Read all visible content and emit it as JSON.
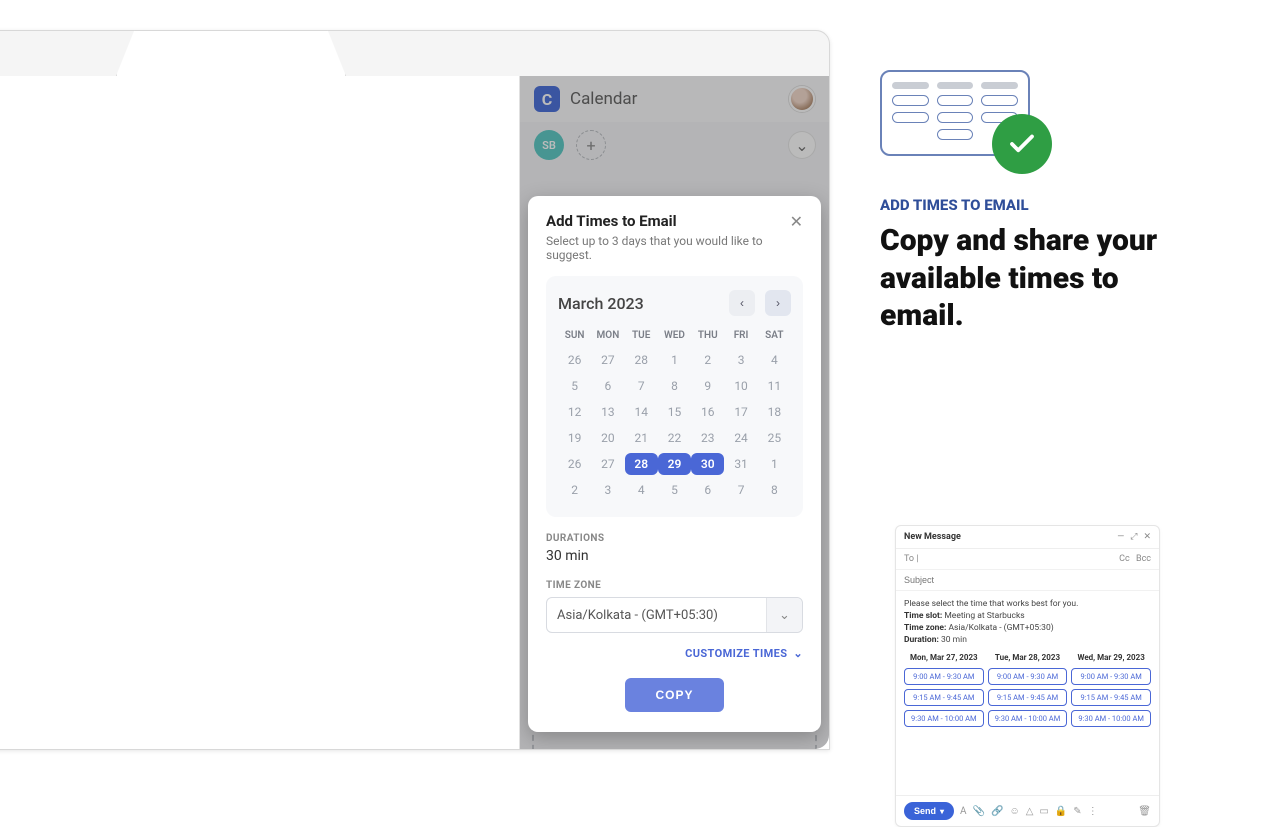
{
  "app": {
    "name": "Calendar",
    "logo_letter": "C",
    "avatar_initials": "",
    "badge_initials": "SB"
  },
  "modal": {
    "title": "Add Times to Email",
    "subtitle": "Select up to 3 days that you would like to suggest.",
    "month_label": "March 2023",
    "dow": [
      "SUN",
      "MON",
      "TUE",
      "WED",
      "THU",
      "FRI",
      "SAT"
    ],
    "days": [
      [
        "26",
        "27",
        "28",
        "1",
        "2",
        "3",
        "4"
      ],
      [
        "5",
        "6",
        "7",
        "8",
        "9",
        "10",
        "11"
      ],
      [
        "12",
        "13",
        "14",
        "15",
        "16",
        "17",
        "18"
      ],
      [
        "19",
        "20",
        "21",
        "22",
        "23",
        "24",
        "25"
      ],
      [
        "26",
        "27",
        "28",
        "29",
        "30",
        "31",
        "1"
      ],
      [
        "2",
        "3",
        "4",
        "5",
        "6",
        "7",
        "8"
      ]
    ],
    "selected_days": [
      "28",
      "29",
      "30"
    ],
    "selected_row": 4,
    "durations_label": "DURATIONS",
    "durations_value": "30 min",
    "timezone_label": "TIME ZONE",
    "timezone_value": "Asia/Kolkata - (GMT+05:30)",
    "customize_label": "CUSTOMIZE TIMES",
    "copy_label": "COPY"
  },
  "promo": {
    "eyebrow": "ADD TIMES TO EMAIL",
    "headline": "Copy and share your available times to email."
  },
  "email": {
    "window_title": "New Message",
    "to_label": "To",
    "cc_label": "Cc",
    "bcc_label": "Bcc",
    "subject_placeholder": "Subject",
    "intro": "Please select the time that works best for you.",
    "slot_label": "Time slot:",
    "slot_value": "Meeting at Starbucks",
    "tz_label": "Time zone:",
    "tz_value": "Asia/Kolkata - (GMT+05:30)",
    "dur_label": "Duration:",
    "dur_value": "30 min",
    "columns": [
      "Mon, Mar 27, 2023",
      "Tue, Mar 28, 2023",
      "Wed, Mar 29, 2023"
    ],
    "slots_rows": [
      [
        "9:00 AM - 9:30 AM",
        "9:00 AM - 9:30 AM",
        "9:00 AM - 9:30 AM"
      ],
      [
        "9:15 AM - 9:45 AM",
        "9:15 AM - 9:45 AM",
        "9:15 AM - 9:45 AM"
      ],
      [
        "9:30 AM - 10:00 AM",
        "9:30 AM - 10:00 AM",
        "9:30 AM - 10:00 AM"
      ]
    ],
    "send_label": "Send"
  }
}
